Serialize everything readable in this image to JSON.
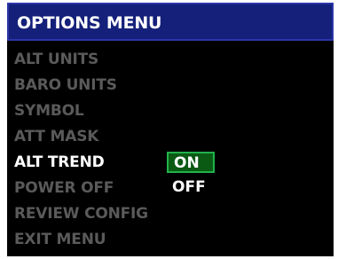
{
  "title": "OPTIONS MENU",
  "menu": {
    "items": [
      {
        "label": "ALT UNITS",
        "state": "dim"
      },
      {
        "label": "BARO UNITS",
        "state": "dim"
      },
      {
        "label": "SYMBOL",
        "state": "dim"
      },
      {
        "label": "ATT MASK",
        "state": "dim"
      },
      {
        "label": "ALT TREND",
        "state": "active"
      },
      {
        "label": "POWER OFF",
        "state": "dim"
      },
      {
        "label": "REVIEW CONFIG",
        "state": "dim"
      },
      {
        "label": "EXIT MENU",
        "state": "dim"
      }
    ]
  },
  "alt_trend_options": {
    "selected": "ON",
    "other": "OFF"
  },
  "colors": {
    "background": "#000000",
    "title_bar": "#14207a",
    "dim_text": "#5a5a5a",
    "active_text": "#ffffff",
    "selection_border": "#22b14c",
    "selection_fill": "#0a5a14"
  }
}
